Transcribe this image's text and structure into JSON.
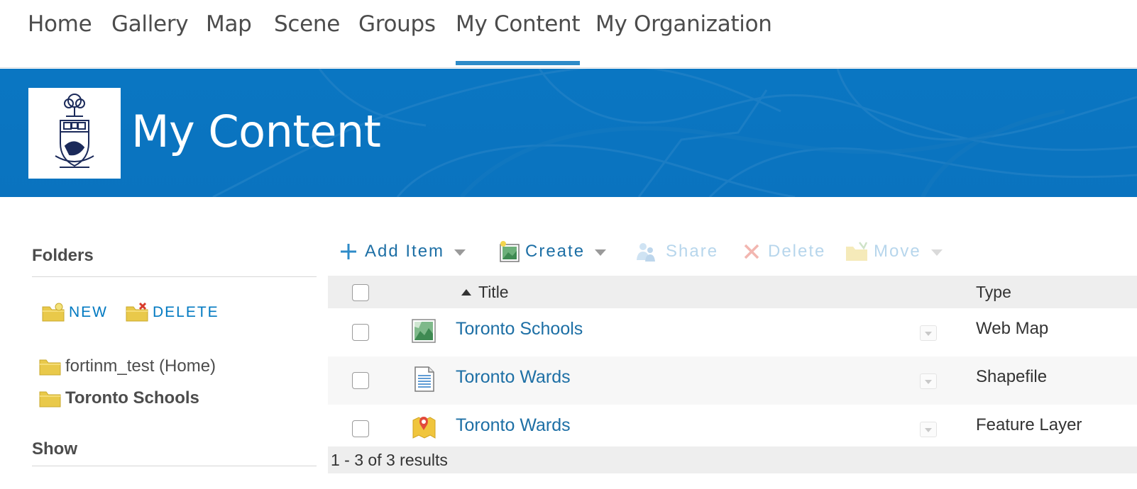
{
  "nav": {
    "items": [
      {
        "label": "Home",
        "active": false
      },
      {
        "label": "Gallery",
        "active": false
      },
      {
        "label": "Map",
        "active": false
      },
      {
        "label": "Scene",
        "active": false
      },
      {
        "label": "Groups",
        "active": false
      },
      {
        "label": "My Content",
        "active": true
      },
      {
        "label": "My Organization",
        "active": false
      }
    ],
    "accent_color": "#2e8bc8"
  },
  "banner": {
    "title": "My Content",
    "background_color": "#0a76c2",
    "logo": "university-crest-logo"
  },
  "sidebar": {
    "folders_heading": "Folders",
    "new_label": "NEW",
    "delete_label": "DELETE",
    "folders": [
      {
        "label": "fortinm_test (Home)",
        "selected": false
      },
      {
        "label": "Toronto Schools",
        "selected": true
      }
    ],
    "show_heading": "Show"
  },
  "toolbar": {
    "add_item": "Add Item",
    "create": "Create",
    "share": "Share",
    "delete": "Delete",
    "move": "Move",
    "enabled_color": "#1d6fa5",
    "disabled_color": "#b7d6ec"
  },
  "table": {
    "columns": {
      "title": "Title",
      "type": "Type"
    },
    "sort": "ascending",
    "rows": [
      {
        "title": "Toronto Schools",
        "type": "Web Map",
        "icon": "web-map-icon"
      },
      {
        "title": "Toronto Wards",
        "type": "Shapefile",
        "icon": "shapefile-icon"
      },
      {
        "title": "Toronto Wards",
        "type": "Feature Layer",
        "icon": "feature-layer-icon"
      }
    ],
    "results": "1 - 3 of 3 results"
  }
}
